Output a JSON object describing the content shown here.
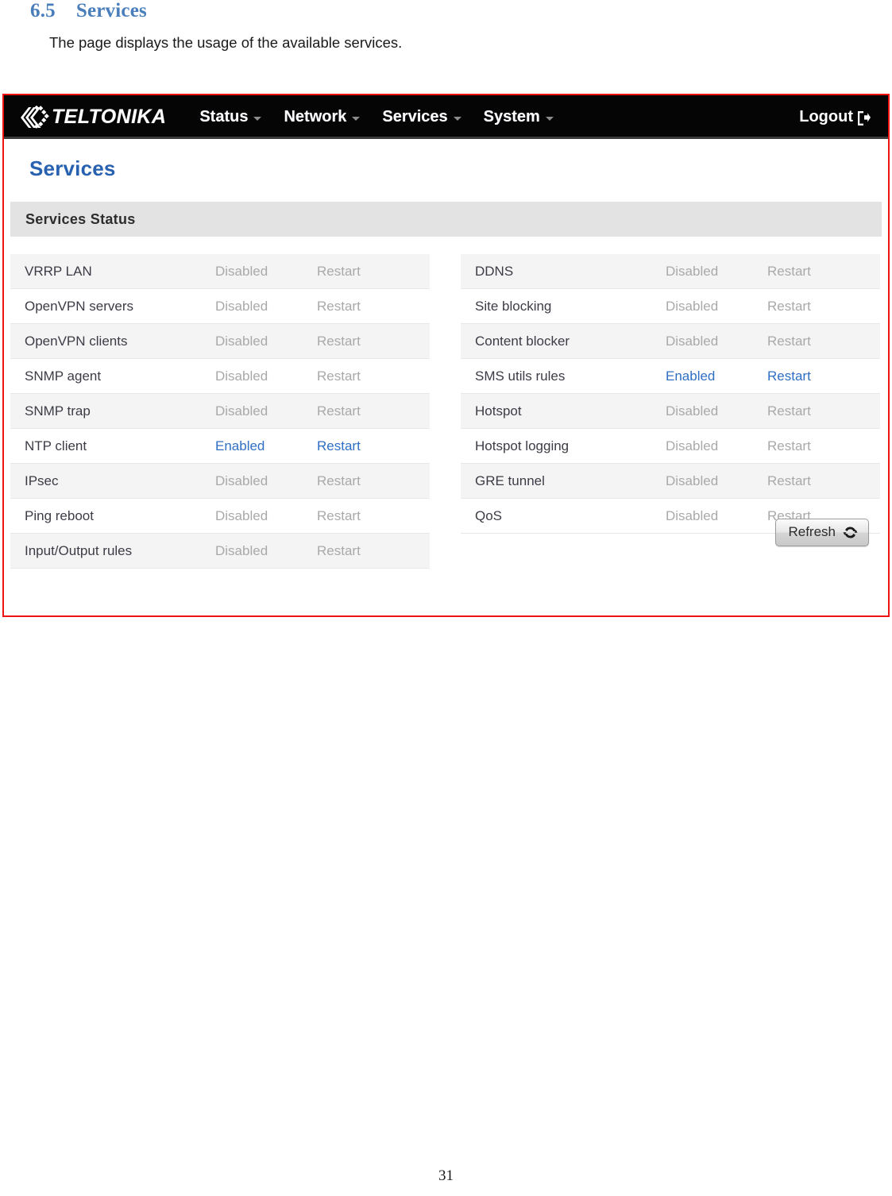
{
  "document": {
    "section_number": "6.5",
    "section_title": "Services",
    "intro_paragraph": "The page displays the usage of the available services.",
    "page_number": "31"
  },
  "browser": {
    "navbar": {
      "logo_text": "TELTONIKA",
      "logo_mark_icon": "teltonika-chevrons-icon",
      "items": [
        {
          "label": "Status",
          "caret_icon": "chevron-down-icon"
        },
        {
          "label": "Network",
          "caret_icon": "chevron-down-icon"
        },
        {
          "label": "Services",
          "caret_icon": "chevron-down-icon"
        },
        {
          "label": "System",
          "caret_icon": "chevron-down-icon"
        }
      ],
      "logout_label": "Logout",
      "logout_icon": "logout-icon"
    },
    "page_title": "Services",
    "section_header": "Services Status",
    "columns": {
      "left": [
        {
          "name": "VRRP LAN",
          "status": "Disabled",
          "action": "Restart"
        },
        {
          "name": "OpenVPN servers",
          "status": "Disabled",
          "action": "Restart"
        },
        {
          "name": "OpenVPN clients",
          "status": "Disabled",
          "action": "Restart"
        },
        {
          "name": "SNMP agent",
          "status": "Disabled",
          "action": "Restart"
        },
        {
          "name": "SNMP trap",
          "status": "Disabled",
          "action": "Restart"
        },
        {
          "name": "NTP client",
          "status": "Enabled",
          "action": "Restart"
        },
        {
          "name": "IPsec",
          "status": "Disabled",
          "action": "Restart"
        },
        {
          "name": "Ping reboot",
          "status": "Disabled",
          "action": "Restart"
        },
        {
          "name": "Input/Output rules",
          "status": "Disabled",
          "action": "Restart"
        }
      ],
      "right": [
        {
          "name": "DDNS",
          "status": "Disabled",
          "action": "Restart"
        },
        {
          "name": "Site blocking",
          "status": "Disabled",
          "action": "Restart"
        },
        {
          "name": "Content blocker",
          "status": "Disabled",
          "action": "Restart"
        },
        {
          "name": "SMS utils rules",
          "status": "Enabled",
          "action": "Restart"
        },
        {
          "name": "Hotspot",
          "status": "Disabled",
          "action": "Restart"
        },
        {
          "name": "Hotspot logging",
          "status": "Disabled",
          "action": "Restart"
        },
        {
          "name": "GRE tunnel",
          "status": "Disabled",
          "action": "Restart"
        },
        {
          "name": "QoS",
          "status": "Disabled",
          "action": "Restart"
        }
      ]
    },
    "refresh_button": {
      "label": "Refresh",
      "icon": "refresh-icon"
    }
  },
  "colors": {
    "heading_blue": "#4a7ebb",
    "page_title_blue": "#2761b0",
    "link_blue": "#2f6fc4",
    "disabled_gray": "#a9a9a9",
    "navbar_black": "#050505",
    "frame_red": "#ee1111",
    "section_band": "#e3e3e3"
  }
}
